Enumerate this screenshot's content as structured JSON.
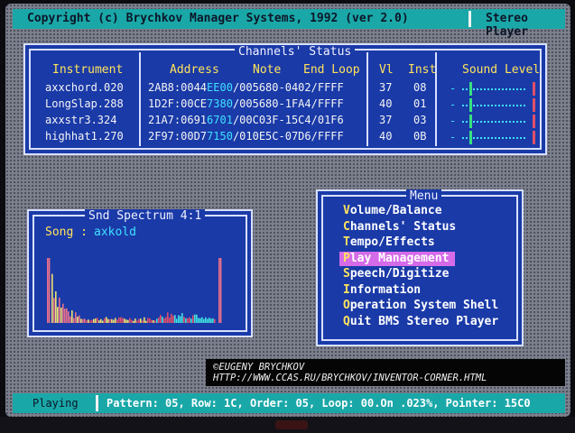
{
  "header": {
    "copyright": "Copyright (c) Brychkov Manager Systems, 1992 (ver 2.0)",
    "app_name": "Stereo Player"
  },
  "channels": {
    "title": "Channels' Status",
    "columns": {
      "instrument": "Instrument",
      "address": "Address",
      "note": "Note",
      "end_loop": "End Loop",
      "vl": "Vl",
      "inst": "Inst",
      "sound_level": "Sound Level"
    },
    "rows": [
      {
        "instrument": "axxchord.020",
        "addr_a": "2AB8:0044",
        "addr_b": "EE00",
        "addr_c": "/005680-0402/FFFF",
        "vl": "37",
        "inst": "08",
        "level": 0.05,
        "peak": 1.0
      },
      {
        "instrument": "LongSlap.288",
        "addr_a": "1D2F:00CE",
        "addr_b": "7380",
        "addr_c": "/005680-1FA4/FFFF",
        "vl": "40",
        "inst": "01",
        "level": 0.05,
        "peak": 1.0
      },
      {
        "instrument": "axxstr3.324",
        "addr_a": "21A7:0691",
        "addr_b": "6701",
        "addr_c": "/00C03F-15C4/01F6",
        "vl": "37",
        "inst": "03",
        "level": 0.05,
        "peak": 1.0
      },
      {
        "instrument": "highhat1.270",
        "addr_a": "2F97:00D7",
        "addr_b": "7150",
        "addr_c": "/010E5C-07D6/FFFF",
        "vl": "40",
        "inst": "0B",
        "level": 0.05,
        "peak": 1.0
      }
    ]
  },
  "spectrum": {
    "title": "Snd Spectrum  4:1",
    "song_label": "Song :",
    "song_name": "axkold"
  },
  "menu": {
    "title": "Menu",
    "items": [
      {
        "hotkey": "V",
        "rest": "olume/Balance"
      },
      {
        "hotkey": "C",
        "rest": "hannels' Status"
      },
      {
        "hotkey": "T",
        "rest": "empo/Effects"
      },
      {
        "hotkey": "P",
        "rest": "lay Management"
      },
      {
        "hotkey": "S",
        "rest": "peech/Digitize"
      },
      {
        "hotkey": "I",
        "rest": "nformation"
      },
      {
        "hotkey": "O",
        "rest": "peration System Shell"
      },
      {
        "hotkey": "Q",
        "rest": "uit BMS Stereo Player"
      }
    ],
    "selected_index": 3
  },
  "watermark": {
    "line1": "©EUGENY BRYCHKOV",
    "line2": "HTTP://WWW.CCAS.RU/BRYCHKOV/INVENTOR-CORNER.HTML"
  },
  "status": {
    "state": "Playing",
    "info": "Pattern: 05, Row: 1C, Order: 05, Loop: 00.On .023%, Pointer: 15C0"
  },
  "colors": {
    "header_bg": "#1aa7a8",
    "panel_bg": "#1a3aa8",
    "highlight": "#d56be8",
    "label_yellow": "#ffe35c",
    "value_cyan": "#3fe0ff"
  }
}
